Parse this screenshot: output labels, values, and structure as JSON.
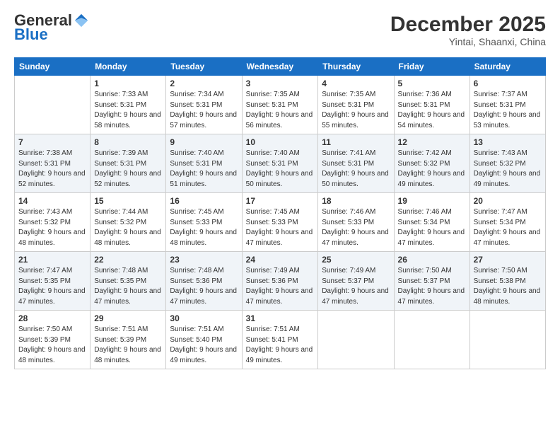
{
  "logo": {
    "general": "General",
    "blue": "Blue"
  },
  "header": {
    "month": "December 2025",
    "location": "Yintai, Shaanxi, China"
  },
  "weekdays": [
    "Sunday",
    "Monday",
    "Tuesday",
    "Wednesday",
    "Thursday",
    "Friday",
    "Saturday"
  ],
  "weeks": [
    [
      {
        "day": "",
        "sunrise": "",
        "sunset": "",
        "daylight": ""
      },
      {
        "day": "1",
        "sunrise": "Sunrise: 7:33 AM",
        "sunset": "Sunset: 5:31 PM",
        "daylight": "Daylight: 9 hours and 58 minutes."
      },
      {
        "day": "2",
        "sunrise": "Sunrise: 7:34 AM",
        "sunset": "Sunset: 5:31 PM",
        "daylight": "Daylight: 9 hours and 57 minutes."
      },
      {
        "day": "3",
        "sunrise": "Sunrise: 7:35 AM",
        "sunset": "Sunset: 5:31 PM",
        "daylight": "Daylight: 9 hours and 56 minutes."
      },
      {
        "day": "4",
        "sunrise": "Sunrise: 7:35 AM",
        "sunset": "Sunset: 5:31 PM",
        "daylight": "Daylight: 9 hours and 55 minutes."
      },
      {
        "day": "5",
        "sunrise": "Sunrise: 7:36 AM",
        "sunset": "Sunset: 5:31 PM",
        "daylight": "Daylight: 9 hours and 54 minutes."
      },
      {
        "day": "6",
        "sunrise": "Sunrise: 7:37 AM",
        "sunset": "Sunset: 5:31 PM",
        "daylight": "Daylight: 9 hours and 53 minutes."
      }
    ],
    [
      {
        "day": "7",
        "sunrise": "Sunrise: 7:38 AM",
        "sunset": "Sunset: 5:31 PM",
        "daylight": "Daylight: 9 hours and 52 minutes."
      },
      {
        "day": "8",
        "sunrise": "Sunrise: 7:39 AM",
        "sunset": "Sunset: 5:31 PM",
        "daylight": "Daylight: 9 hours and 52 minutes."
      },
      {
        "day": "9",
        "sunrise": "Sunrise: 7:40 AM",
        "sunset": "Sunset: 5:31 PM",
        "daylight": "Daylight: 9 hours and 51 minutes."
      },
      {
        "day": "10",
        "sunrise": "Sunrise: 7:40 AM",
        "sunset": "Sunset: 5:31 PM",
        "daylight": "Daylight: 9 hours and 50 minutes."
      },
      {
        "day": "11",
        "sunrise": "Sunrise: 7:41 AM",
        "sunset": "Sunset: 5:31 PM",
        "daylight": "Daylight: 9 hours and 50 minutes."
      },
      {
        "day": "12",
        "sunrise": "Sunrise: 7:42 AM",
        "sunset": "Sunset: 5:32 PM",
        "daylight": "Daylight: 9 hours and 49 minutes."
      },
      {
        "day": "13",
        "sunrise": "Sunrise: 7:43 AM",
        "sunset": "Sunset: 5:32 PM",
        "daylight": "Daylight: 9 hours and 49 minutes."
      }
    ],
    [
      {
        "day": "14",
        "sunrise": "Sunrise: 7:43 AM",
        "sunset": "Sunset: 5:32 PM",
        "daylight": "Daylight: 9 hours and 48 minutes."
      },
      {
        "day": "15",
        "sunrise": "Sunrise: 7:44 AM",
        "sunset": "Sunset: 5:32 PM",
        "daylight": "Daylight: 9 hours and 48 minutes."
      },
      {
        "day": "16",
        "sunrise": "Sunrise: 7:45 AM",
        "sunset": "Sunset: 5:33 PM",
        "daylight": "Daylight: 9 hours and 48 minutes."
      },
      {
        "day": "17",
        "sunrise": "Sunrise: 7:45 AM",
        "sunset": "Sunset: 5:33 PM",
        "daylight": "Daylight: 9 hours and 47 minutes."
      },
      {
        "day": "18",
        "sunrise": "Sunrise: 7:46 AM",
        "sunset": "Sunset: 5:33 PM",
        "daylight": "Daylight: 9 hours and 47 minutes."
      },
      {
        "day": "19",
        "sunrise": "Sunrise: 7:46 AM",
        "sunset": "Sunset: 5:34 PM",
        "daylight": "Daylight: 9 hours and 47 minutes."
      },
      {
        "day": "20",
        "sunrise": "Sunrise: 7:47 AM",
        "sunset": "Sunset: 5:34 PM",
        "daylight": "Daylight: 9 hours and 47 minutes."
      }
    ],
    [
      {
        "day": "21",
        "sunrise": "Sunrise: 7:47 AM",
        "sunset": "Sunset: 5:35 PM",
        "daylight": "Daylight: 9 hours and 47 minutes."
      },
      {
        "day": "22",
        "sunrise": "Sunrise: 7:48 AM",
        "sunset": "Sunset: 5:35 PM",
        "daylight": "Daylight: 9 hours and 47 minutes."
      },
      {
        "day": "23",
        "sunrise": "Sunrise: 7:48 AM",
        "sunset": "Sunset: 5:36 PM",
        "daylight": "Daylight: 9 hours and 47 minutes."
      },
      {
        "day": "24",
        "sunrise": "Sunrise: 7:49 AM",
        "sunset": "Sunset: 5:36 PM",
        "daylight": "Daylight: 9 hours and 47 minutes."
      },
      {
        "day": "25",
        "sunrise": "Sunrise: 7:49 AM",
        "sunset": "Sunset: 5:37 PM",
        "daylight": "Daylight: 9 hours and 47 minutes."
      },
      {
        "day": "26",
        "sunrise": "Sunrise: 7:50 AM",
        "sunset": "Sunset: 5:37 PM",
        "daylight": "Daylight: 9 hours and 47 minutes."
      },
      {
        "day": "27",
        "sunrise": "Sunrise: 7:50 AM",
        "sunset": "Sunset: 5:38 PM",
        "daylight": "Daylight: 9 hours and 48 minutes."
      }
    ],
    [
      {
        "day": "28",
        "sunrise": "Sunrise: 7:50 AM",
        "sunset": "Sunset: 5:39 PM",
        "daylight": "Daylight: 9 hours and 48 minutes."
      },
      {
        "day": "29",
        "sunrise": "Sunrise: 7:51 AM",
        "sunset": "Sunset: 5:39 PM",
        "daylight": "Daylight: 9 hours and 48 minutes."
      },
      {
        "day": "30",
        "sunrise": "Sunrise: 7:51 AM",
        "sunset": "Sunset: 5:40 PM",
        "daylight": "Daylight: 9 hours and 49 minutes."
      },
      {
        "day": "31",
        "sunrise": "Sunrise: 7:51 AM",
        "sunset": "Sunset: 5:41 PM",
        "daylight": "Daylight: 9 hours and 49 minutes."
      },
      {
        "day": "",
        "sunrise": "",
        "sunset": "",
        "daylight": ""
      },
      {
        "day": "",
        "sunrise": "",
        "sunset": "",
        "daylight": ""
      },
      {
        "day": "",
        "sunrise": "",
        "sunset": "",
        "daylight": ""
      }
    ]
  ]
}
